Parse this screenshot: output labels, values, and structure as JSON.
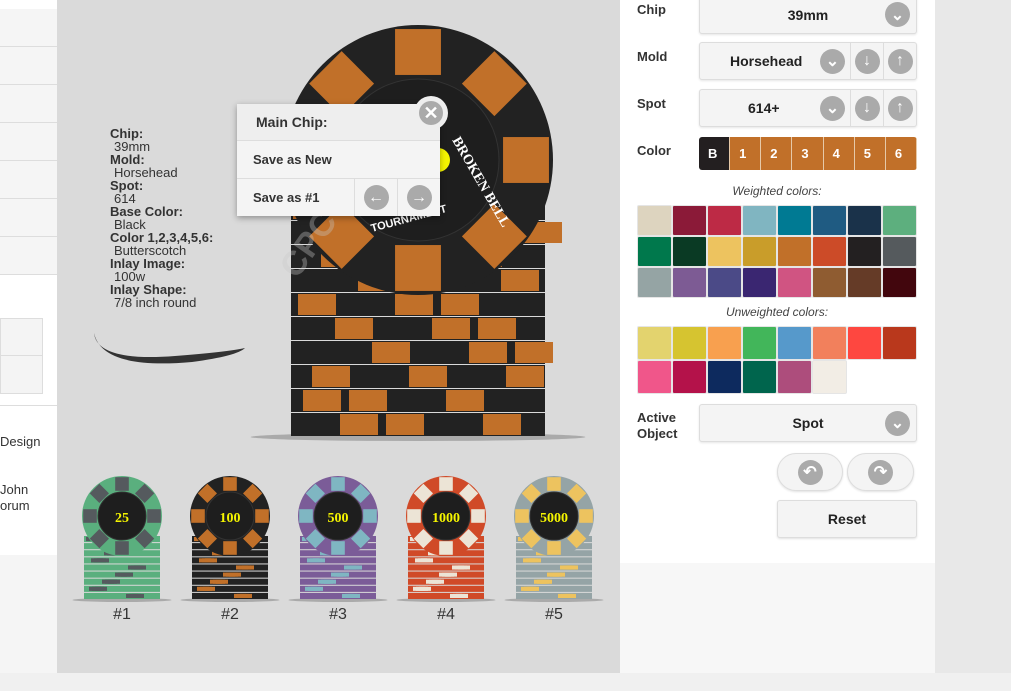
{
  "sidebar": {
    "text_design": "Design",
    "text_john": "John",
    "text_forum": "orum"
  },
  "spec": {
    "chip_label": "Chip:",
    "chip_value": "39mm",
    "mold_label": "Mold:",
    "mold_value": "Horsehead",
    "spot_label": "Spot:",
    "spot_value": "614",
    "base_label": "Base Color:",
    "base_value": "Black",
    "colors_label": "Color 1,2,3,4,5,6:",
    "colors_value": "Butterscotch",
    "inlay_image_label": "Inlay Image:",
    "inlay_image_value": "100w",
    "inlay_shape_label": "Inlay Shape:",
    "inlay_shape_value": "7/8 inch round"
  },
  "popup": {
    "title": "Main Chip:",
    "save_new": "Save as New",
    "save_num": "Save as #1",
    "close_icon": "close-icon",
    "prev_icon": "arrow-left-icon",
    "next_icon": "arrow-right-icon"
  },
  "main_chip": {
    "base": "#222222",
    "spot": "#c17029",
    "text_top": "BROKEN BELL",
    "text_bottom": "TOURNAMENT",
    "watermark": "CPC 2015"
  },
  "thumbnails": [
    {
      "label": "#1",
      "value": "25",
      "base": "#5aaf7e",
      "spot": "#555a5e"
    },
    {
      "label": "#2",
      "value": "100",
      "base": "#222222",
      "spot": "#c17029"
    },
    {
      "label": "#3",
      "value": "500",
      "base": "#7b5c98",
      "spot": "#7fb6c2"
    },
    {
      "label": "#4",
      "value": "1000",
      "base": "#d04a28",
      "spot": "#ece4d6"
    },
    {
      "label": "#5",
      "value": "5000",
      "base": "#95a4a6",
      "spot": "#edc35f"
    }
  ],
  "controls": {
    "chip": {
      "label": "Chip",
      "value": "39mm"
    },
    "mold": {
      "label": "Mold",
      "value": "Horsehead"
    },
    "spot": {
      "label": "Spot",
      "value": "614+"
    },
    "color": {
      "label": "Color",
      "cells": [
        "B",
        "1",
        "2",
        "3",
        "4",
        "5",
        "6"
      ],
      "base_color": "#231f20",
      "spot_color": "#c17029"
    },
    "weighted_label": "Weighted colors:",
    "weighted_colors": [
      "#ddd4bf",
      "#8b1a38",
      "#bd2a45",
      "#80b5c1",
      "#007a93",
      "#1f5b82",
      "#1a324a",
      "#5daf7e",
      "#00784c",
      "#0a3a24",
      "#edc35f",
      "#c99d2a",
      "#c17029",
      "#cc4b28",
      "#232021",
      "#555a5d",
      "#95a4a4",
      "#7d5b94",
      "#4b4a87",
      "#3a2671",
      "#d05482",
      "#8f5c31",
      "#653b27",
      "#42060d"
    ],
    "unweighted_label": "Unweighted colors:",
    "unweighted_colors": [
      "#e3d36e",
      "#d6c430",
      "#f8a04f",
      "#42b65a",
      "#5699cb",
      "#f2805c",
      "#fe4740",
      "#b9381c",
      "#f0568a",
      "#b4124a",
      "#0d2a5e",
      "#00654d",
      "#ad4d7c",
      "#f2ede5"
    ],
    "active_object": {
      "label_line1": "Active",
      "label_line2": "Object",
      "value": "Spot"
    },
    "reset": "Reset"
  }
}
